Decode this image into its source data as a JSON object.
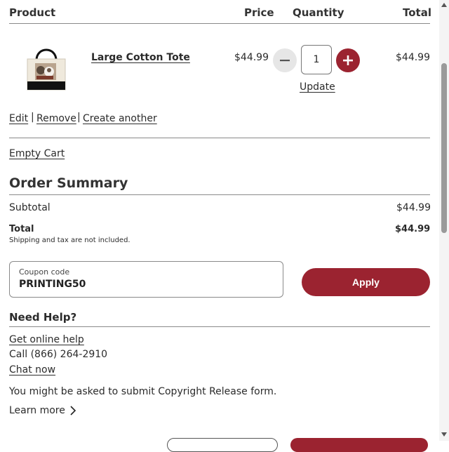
{
  "table_header": {
    "product": "Product",
    "price": "Price",
    "quantity": "Quantity",
    "total": "Total"
  },
  "cart_item": {
    "name": "Large Cotton Tote",
    "price": "$44.99",
    "quantity": "1",
    "update_label": "Update",
    "total": "$44.99",
    "thumbnail_icon": "tote-bag-thumbnail"
  },
  "item_actions": {
    "edit": "Edit",
    "sep1": "|",
    "remove": "Remove",
    "sep2": "|",
    "create_another": "Create another"
  },
  "empty_cart": "Empty Cart",
  "order_summary": {
    "title": "Order Summary",
    "subtotal_label": "Subtotal",
    "subtotal_value": "$44.99",
    "total_label": "Total",
    "total_value": "$44.99",
    "note": "Shipping and tax are not included."
  },
  "coupon": {
    "label": "Coupon code",
    "value": "PRINTING50",
    "apply_label": "Apply"
  },
  "help": {
    "title": "Need Help?",
    "online_help": "Get online help",
    "phone": "Call (866) 264-2910",
    "chat": "Chat now"
  },
  "copyright": {
    "notice": "You might be asked to submit Copyright Release form.",
    "learn_more": "Learn more"
  },
  "colors": {
    "accent": "#9b2330",
    "minus_bg": "#e6e6e6"
  }
}
